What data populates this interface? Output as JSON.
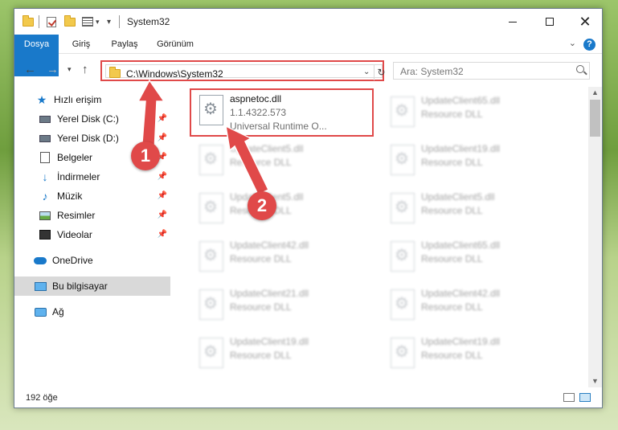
{
  "window": {
    "title": "System32",
    "controls": {
      "minimize": "minimize-icon",
      "maximize": "maximize-icon",
      "close": "close-icon"
    }
  },
  "ribbon": {
    "tabs": [
      {
        "label": "Dosya",
        "active": true
      },
      {
        "label": "Giriş"
      },
      {
        "label": "Paylaş"
      },
      {
        "label": "Görünüm"
      }
    ],
    "help": "?"
  },
  "nav": {
    "address": "C:\\Windows\\System32",
    "search_placeholder": "Ara: System32",
    "refresh_glyph": "↻"
  },
  "sidebar": {
    "items": [
      {
        "label": "Hızlı erişim",
        "icon": "star-icon"
      },
      {
        "label": "Yerel Disk (C:)",
        "icon": "drive-icon",
        "pinned": true
      },
      {
        "label": "Yerel Disk (D:)",
        "icon": "drive-icon",
        "pinned": true
      },
      {
        "label": "Belgeler",
        "icon": "documents-icon",
        "pinned": true
      },
      {
        "label": "İndirmeler",
        "icon": "downloads-icon",
        "pinned": true
      },
      {
        "label": "Müzik",
        "icon": "music-icon",
        "pinned": true
      },
      {
        "label": "Resimler",
        "icon": "pictures-icon",
        "pinned": true
      },
      {
        "label": "Videolar",
        "icon": "videos-icon",
        "pinned": true
      },
      {
        "label": "OneDrive",
        "icon": "onedrive-icon"
      },
      {
        "label": "Bu bilgisayar",
        "icon": "computer-icon",
        "selected": true
      },
      {
        "label": "Ağ",
        "icon": "network-icon"
      }
    ]
  },
  "files": {
    "left": [
      {
        "name": "aspnetoc.dll",
        "version": "1.1.4322.573",
        "desc": "Universal Runtime O...",
        "highlight": true
      },
      {
        "name": "UpdateClient5.dll",
        "version": "Resource DLL"
      },
      {
        "name": "UpdateClient5.dll",
        "version": "Resource DLL"
      },
      {
        "name": "UpdateClient42.dll",
        "version": "Resource DLL"
      },
      {
        "name": "UpdateClient21.dll",
        "version": "Resource DLL"
      },
      {
        "name": "UpdateClient19.dll",
        "version": "Resource DLL"
      }
    ],
    "right": [
      {
        "name": "UpdateClient65.dll",
        "version": "Resource DLL"
      },
      {
        "name": "UpdateClient19.dll",
        "version": "Resource DLL"
      },
      {
        "name": "UpdateClient5.dll",
        "version": "Resource DLL"
      },
      {
        "name": "UpdateClient65.dll",
        "version": "Resource DLL"
      },
      {
        "name": "UpdateClient42.dll",
        "version": "Resource DLL"
      },
      {
        "name": "UpdateClient19.dll",
        "version": "Resource DLL"
      }
    ]
  },
  "status": {
    "count": "192 öğe"
  },
  "annotations": {
    "badge1": "1",
    "badge2": "2",
    "color": "#e04949"
  }
}
